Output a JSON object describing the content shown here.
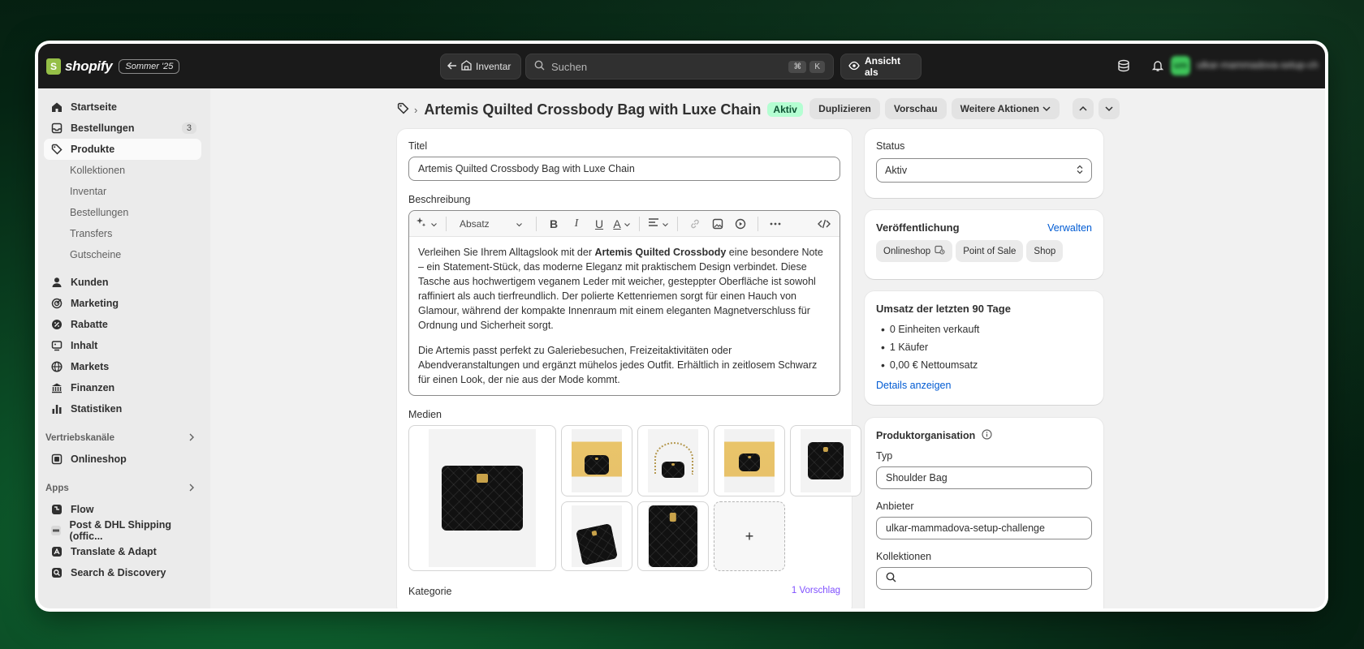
{
  "app": {
    "logo_text": "shopify",
    "edition": "Sommer '25",
    "nav_back_label": "Inventar",
    "search_placeholder": "Suchen",
    "shortcut_keys": [
      "⌘",
      "K"
    ],
    "view_as_label": "Ansicht als",
    "avatar_initials": "um",
    "store_name": "ulkar-mammadova-setup-challenge"
  },
  "sidebar": {
    "items": [
      {
        "label": "Startseite",
        "icon": "home-icon"
      },
      {
        "label": "Bestellungen",
        "icon": "inbox-icon",
        "count": "3"
      },
      {
        "label": "Produkte",
        "icon": "tag-icon",
        "active": true
      }
    ],
    "product_subitems": [
      "Kollektionen",
      "Inventar",
      "Bestellungen",
      "Transfers",
      "Gutscheine"
    ],
    "items2": [
      {
        "label": "Kunden",
        "icon": "person-icon"
      },
      {
        "label": "Marketing",
        "icon": "target-icon"
      },
      {
        "label": "Rabatte",
        "icon": "discount-icon"
      },
      {
        "label": "Inhalt",
        "icon": "content-icon"
      },
      {
        "label": "Markets",
        "icon": "globe-icon"
      },
      {
        "label": "Finanzen",
        "icon": "bank-icon"
      },
      {
        "label": "Statistiken",
        "icon": "chart-icon"
      }
    ],
    "sales_channels_label": "Vertriebskanäle",
    "sales_channels": [
      {
        "label": "Onlineshop",
        "icon": "store-icon"
      }
    ],
    "apps_label": "Apps",
    "apps": [
      {
        "label": "Flow",
        "icon": "flow-icon"
      },
      {
        "label": "Post & DHL Shipping (offic...",
        "icon": "dhl-icon"
      },
      {
        "label": "Translate & Adapt",
        "icon": "translate-icon"
      },
      {
        "label": "Search & Discovery",
        "icon": "search-discovery-icon"
      }
    ]
  },
  "header": {
    "title": "Artemis Quilted Crossbody Bag with Luxe Chain",
    "status_badge": "Aktiv",
    "duplicate_label": "Duplizieren",
    "preview_label": "Vorschau",
    "more_actions_label": "Weitere Aktionen"
  },
  "product": {
    "title_label": "Titel",
    "title_value": "Artemis Quilted Crossbody Bag with Luxe Chain",
    "description_label": "Beschreibung",
    "paragraph_format": "Absatz",
    "description_p1_pre": "Verleihen Sie Ihrem Alltagslook mit der ",
    "description_p1_bold": "Artemis Quilted Crossbody",
    "description_p1_post": " eine besondere Note – ein Statement-Stück, das moderne Eleganz mit praktischem Design verbindet. Diese Tasche aus hochwertigem veganem Leder mit weicher, gesteppter Oberfläche ist sowohl raffiniert als auch tierfreundlich. Der polierte Kettenriemen sorgt für einen Hauch von Glamour, während der kompakte Innenraum mit einem eleganten Magnetverschluss für Ordnung und Sicherheit sorgt.",
    "description_p2": "Die Artemis passt perfekt zu Galeriebesuchen, Freizeitaktivitäten oder Abendveranstaltungen und ergänzt mühelos jedes Outfit. Erhältlich in zeitlosem Schwarz für einen Look, der nie aus der Mode kommt.",
    "media_label": "Medien",
    "add_media": "+",
    "category_label": "Kategorie",
    "category_suggestion": "1 Vorschlag"
  },
  "status_card": {
    "label": "Status",
    "value": "Aktiv"
  },
  "publishing_card": {
    "title": "Veröffentlichung",
    "manage_link": "Verwalten",
    "channels": [
      "Onlineshop",
      "Point of Sale",
      "Shop"
    ]
  },
  "sales_card": {
    "title": "Umsatz der letzten 90 Tage",
    "stats": [
      "0 Einheiten verkauft",
      "1 Käufer",
      "0,00 € Nettoumsatz"
    ],
    "details_link": "Details anzeigen"
  },
  "organization_card": {
    "title": "Produktorganisation",
    "type_label": "Typ",
    "type_value": "Shoulder Bag",
    "vendor_label": "Anbieter",
    "vendor_value": "ulkar-mammadova-setup-challenge",
    "collections_label": "Kollektionen"
  },
  "colors": {
    "accent_link": "#005bd3",
    "active_badge_bg": "#b4fed2",
    "topbar": "#1a1a1a",
    "suggest": "#8051ff"
  }
}
